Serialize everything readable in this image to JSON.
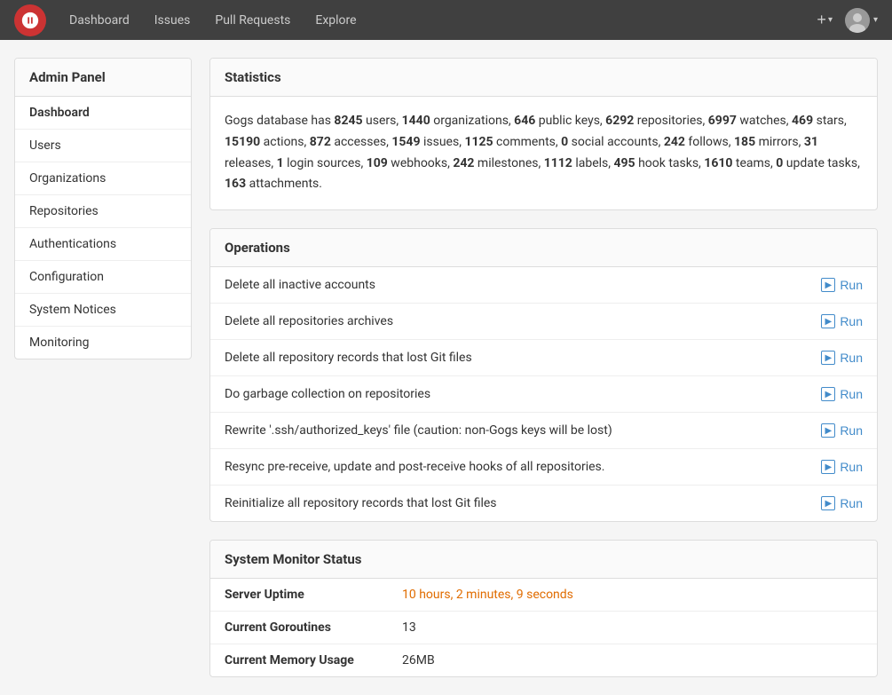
{
  "header": {
    "nav": [
      {
        "label": "Dashboard",
        "id": "nav-dashboard"
      },
      {
        "label": "Issues",
        "id": "nav-issues"
      },
      {
        "label": "Pull Requests",
        "id": "nav-pull-requests"
      },
      {
        "label": "Explore",
        "id": "nav-explore"
      }
    ],
    "add_label": "+",
    "chevron": "▾"
  },
  "sidebar": {
    "title": "Admin Panel",
    "items": [
      {
        "label": "Dashboard",
        "id": "sidebar-dashboard",
        "active": true
      },
      {
        "label": "Users",
        "id": "sidebar-users"
      },
      {
        "label": "Organizations",
        "id": "sidebar-organizations"
      },
      {
        "label": "Repositories",
        "id": "sidebar-repositories"
      },
      {
        "label": "Authentications",
        "id": "sidebar-authentications"
      },
      {
        "label": "Configuration",
        "id": "sidebar-configuration"
      },
      {
        "label": "System Notices",
        "id": "sidebar-system-notices"
      },
      {
        "label": "Monitoring",
        "id": "sidebar-monitoring"
      }
    ]
  },
  "statistics": {
    "title": "Statistics",
    "text_intro": "Gogs database has ",
    "stats": {
      "users": "8245",
      "organizations": "1440",
      "public_keys": "646",
      "repositories": "6292",
      "watches": "6997",
      "stars": "469",
      "actions": "15190",
      "accesses": "872",
      "issues": "1549",
      "comments": "1125",
      "social_accounts": "0",
      "follows": "242",
      "mirrors": "185",
      "releases": "31",
      "login_sources": "1",
      "webhooks": "109",
      "milestones": "242",
      "labels": "1112",
      "hook_tasks": "495",
      "teams": "1610",
      "update_tasks": "0",
      "attachments": "163"
    }
  },
  "operations": {
    "title": "Operations",
    "items": [
      {
        "label": "Delete all inactive accounts",
        "run": "Run"
      },
      {
        "label": "Delete all repositories archives",
        "run": "Run"
      },
      {
        "label": "Delete all repository records that lost Git files",
        "run": "Run"
      },
      {
        "label": "Do garbage collection on repositories",
        "run": "Run"
      },
      {
        "label": "Rewrite '.ssh/authorized_keys' file (caution: non-Gogs keys will be lost)",
        "run": "Run"
      },
      {
        "label": "Resync pre-receive, update and post-receive hooks of all repositories.",
        "run": "Run"
      },
      {
        "label": "Reinitialize all repository records that lost Git files",
        "run": "Run"
      }
    ]
  },
  "system_monitor": {
    "title": "System Monitor Status",
    "rows": [
      {
        "label": "Server Uptime",
        "value": "10 hours, 2 minutes, 9 seconds",
        "colored": true
      },
      {
        "label": "Current Goroutines",
        "value": "13",
        "colored": false
      },
      {
        "label": "Current Memory Usage",
        "value": "26MB",
        "colored": false
      }
    ]
  }
}
